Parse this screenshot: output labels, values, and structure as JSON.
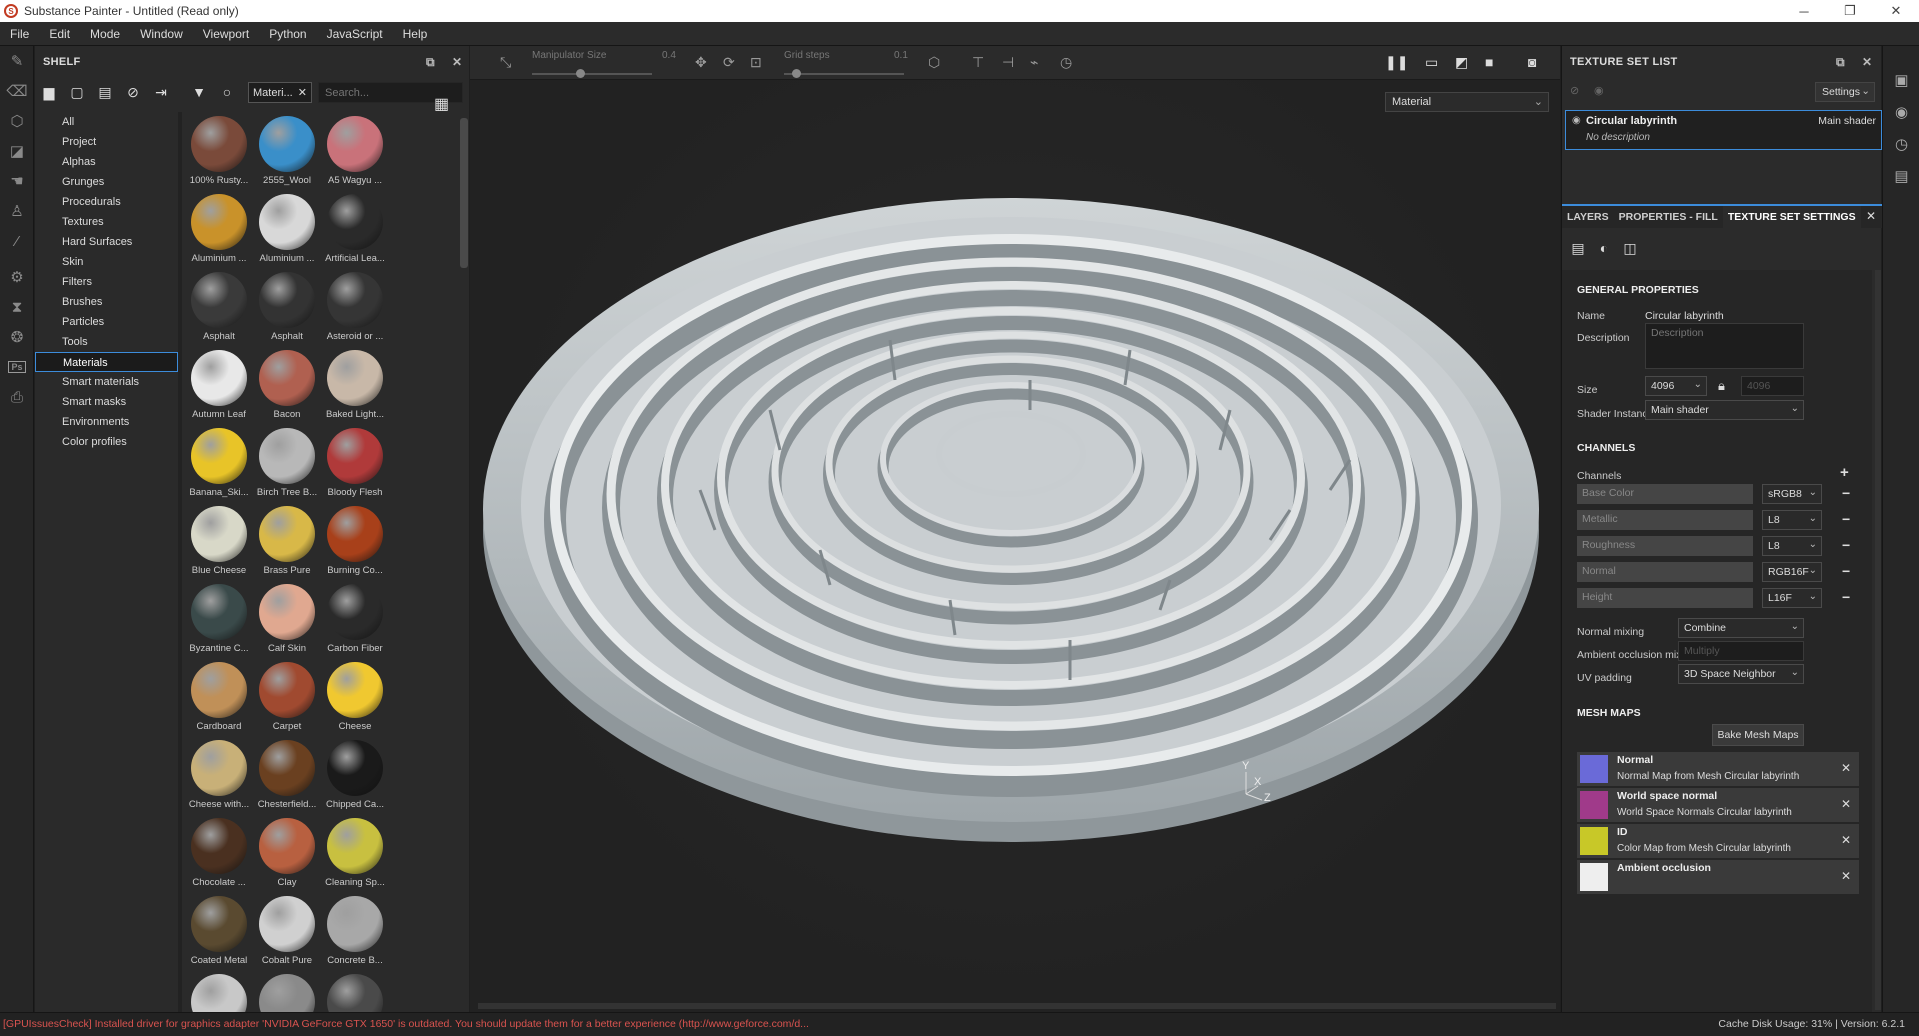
{
  "window": {
    "title": "Substance Painter - Untitled (Read only)",
    "controls": [
      "─",
      "❐",
      "✕"
    ]
  },
  "menu": [
    "File",
    "Edit",
    "Mode",
    "Window",
    "Viewport",
    "Python",
    "JavaScript",
    "Help"
  ],
  "left_tools": [
    "brush-icon",
    "eraser-icon",
    "projection-icon",
    "geometry-mask-icon",
    "smudge-icon",
    "clone-icon",
    "color-picker-icon",
    "settings-icon",
    "hourglass-icon",
    "3d-icon",
    "photoshop-icon",
    "export-icon"
  ],
  "shelf": {
    "title": "SHELF",
    "filter_label": "Materi...",
    "search_placeholder": "Search...",
    "categories": [
      "All",
      "Project",
      "Alphas",
      "Grunges",
      "Procedurals",
      "Textures",
      "Hard Surfaces",
      "Skin",
      "Filters",
      "Brushes",
      "Particles",
      "Tools",
      "Materials",
      "Smart materials",
      "Smart masks",
      "Environments",
      "Color profiles"
    ],
    "active_category": "Materials",
    "materials": [
      {
        "label": "100% Rusty...",
        "color": "#7a4a3a"
      },
      {
        "label": "2555_Wool",
        "color": "#3a8fc9"
      },
      {
        "label": "A5 Wagyu ...",
        "color": "#c9727a"
      },
      {
        "label": "Aluminium ...",
        "color": "#c9922a"
      },
      {
        "label": "Aluminium ...",
        "color": "#d8d8d8"
      },
      {
        "label": "Artificial Lea...",
        "color": "#2a2a2a"
      },
      {
        "label": "Asphalt",
        "color": "#3a3a3a"
      },
      {
        "label": "Asphalt",
        "color": "#333333"
      },
      {
        "label": "Asteroid or ...",
        "color": "#353535"
      },
      {
        "label": "Autumn Leaf",
        "color": "#e8e8e8"
      },
      {
        "label": "Bacon",
        "color": "#b06050"
      },
      {
        "label": "Baked Light...",
        "color": "#c8b8a8"
      },
      {
        "label": "Banana_Ski...",
        "color": "#e8c428"
      },
      {
        "label": "Birch Tree B...",
        "color": "#b8b8b8"
      },
      {
        "label": "Bloody Flesh",
        "color": "#b03a3a"
      },
      {
        "label": "Blue Cheese",
        "color": "#d8d8c8"
      },
      {
        "label": "Brass Pure",
        "color": "#d8b848"
      },
      {
        "label": "Burning Co...",
        "color": "#a8401a"
      },
      {
        "label": "Byzantine C...",
        "color": "#3a4a4a"
      },
      {
        "label": "Calf Skin",
        "color": "#e0a890"
      },
      {
        "label": "Carbon Fiber",
        "color": "#2a2a2a"
      },
      {
        "label": "Cardboard",
        "color": "#c09058"
      },
      {
        "label": "Carpet",
        "color": "#a04a30"
      },
      {
        "label": "Cheese",
        "color": "#f0c830"
      },
      {
        "label": "Cheese with...",
        "color": "#c8b078"
      },
      {
        "label": "Chesterfield...",
        "color": "#6a4020"
      },
      {
        "label": "Chipped Ca...",
        "color": "#1a1a1a"
      },
      {
        "label": "Chocolate ...",
        "color": "#4a3020"
      },
      {
        "label": "Clay",
        "color": "#b86040"
      },
      {
        "label": "Cleaning Sp...",
        "color": "#c8c040"
      },
      {
        "label": "Coated Metal",
        "color": "#5a4a30"
      },
      {
        "label": "Cobalt Pure",
        "color": "#d0d0d0"
      },
      {
        "label": "Concrete B...",
        "color": "#a8a8a8"
      },
      {
        "label": "",
        "color": "#c8c8c8"
      },
      {
        "label": "",
        "color": "#8a8a8a"
      },
      {
        "label": "",
        "color": "#4a4a4a"
      }
    ]
  },
  "viewport_toolbar": {
    "manipulator_label": "Manipulator Size",
    "manipulator_value": "0.4",
    "manipulator_fraction": 0.4,
    "grid_label": "Grid steps",
    "grid_value": "0.1",
    "grid_fraction": 0.1
  },
  "viewport": {
    "mode_select": "Material",
    "axis": {
      "y": "Y",
      "x": "X",
      "z": "Z"
    }
  },
  "texture_set_list": {
    "title": "TEXTURE SET LIST",
    "settings_label": "Settings",
    "item": {
      "name": "Circular labyrinth",
      "description": "No description",
      "shader": "Main shader"
    }
  },
  "tabs": [
    {
      "label": "LAYERS",
      "active": false
    },
    {
      "label": "PROPERTIES - FILL",
      "active": false
    },
    {
      "label": "TEXTURE SET SETTINGS",
      "active": true
    }
  ],
  "tss": {
    "general_title": "GENERAL PROPERTIES",
    "name_label": "Name",
    "name_value": "Circular labyrinth",
    "description_label": "Description",
    "description_placeholder": "Description",
    "size_label": "Size",
    "size_value": "4096",
    "size_value2": "4096",
    "shader_label": "Shader Instance",
    "shader_value": "Main shader",
    "channels_title": "CHANNELS",
    "channels_label": "Channels",
    "channels": [
      {
        "name": "Base Color",
        "format": "sRGB8"
      },
      {
        "name": "Metallic",
        "format": "L8"
      },
      {
        "name": "Roughness",
        "format": "L8"
      },
      {
        "name": "Normal",
        "format": "RGB16F"
      },
      {
        "name": "Height",
        "format": "L16F"
      }
    ],
    "normal_mixing_label": "Normal mixing",
    "normal_mixing_value": "Combine",
    "ao_mixing_label": "Ambient occlusion mixing",
    "ao_mixing_value": "Multiply",
    "uv_padding_label": "UV padding",
    "uv_padding_value": "3D Space Neighbor",
    "mesh_maps_title": "MESH MAPS",
    "bake_label": "Bake Mesh Maps",
    "mesh_maps": [
      {
        "title": "Normal",
        "subtitle": "Normal Map from Mesh Circular labyrinth",
        "color": "#6a6ad8"
      },
      {
        "title": "World space normal",
        "subtitle": "World Space Normals Circular labyrinth",
        "color": "#a03a8a"
      },
      {
        "title": "ID",
        "subtitle": "Color Map from Mesh Circular labyrinth",
        "color": "#c8c828"
      },
      {
        "title": "Ambient occlusion",
        "subtitle": "",
        "color": "#eeeeee"
      }
    ]
  },
  "right_strip": [
    "display-settings-icon",
    "environment-icon",
    "history-icon",
    "log-icon"
  ],
  "status": {
    "message": "[GPUIssuesCheck] Installed driver for graphics adapter 'NVIDIA GeForce GTX 1650' is outdated. You should update them for a better experience (http://www.geforce.com/d...",
    "right": "Cache Disk Usage:   31% | Version: 6.2.1"
  }
}
